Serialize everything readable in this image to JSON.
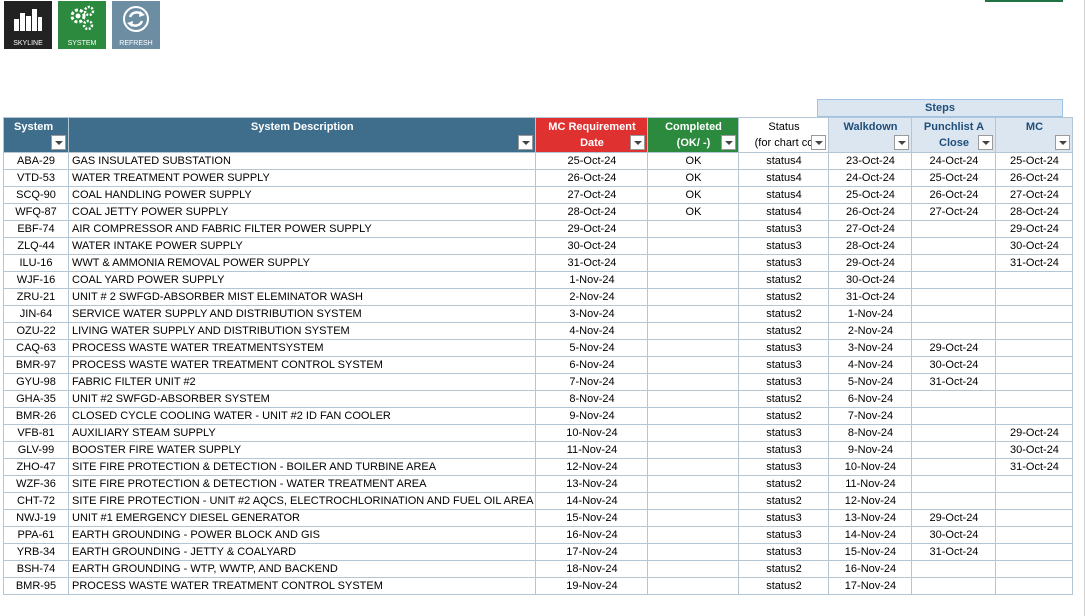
{
  "toolbar": [
    {
      "label": "SKYLINE",
      "icon": "skyline-icon"
    },
    {
      "label": "SYSTEM",
      "icon": "gears-icon"
    },
    {
      "label": "REFRESH",
      "icon": "refresh-icon"
    }
  ],
  "steps_label": "Steps",
  "headers": {
    "system": "System",
    "desc": "System Description",
    "mc_req_l1": "MC Requirement",
    "mc_req_l2": "Date",
    "completed_l1": "Completed",
    "completed_l2": "(OK/ -)",
    "status_l1": "Status",
    "status_l2": "(for chart co",
    "walkdown": "Walkdown",
    "punch_l1": "Punchlist A",
    "punch_l2": "Close",
    "mc": "MC"
  },
  "rows": [
    [
      "ABA-29",
      "GAS INSULATED SUBSTATION",
      "25-Oct-24",
      "OK",
      "status4",
      "23-Oct-24",
      "24-Oct-24",
      "25-Oct-24"
    ],
    [
      "VTD-53",
      "WATER TREATMENT POWER SUPPLY",
      "26-Oct-24",
      "OK",
      "status4",
      "24-Oct-24",
      "25-Oct-24",
      "26-Oct-24"
    ],
    [
      "SCQ-90",
      "COAL HANDLING POWER SUPPLY",
      "27-Oct-24",
      "OK",
      "status4",
      "25-Oct-24",
      "26-Oct-24",
      "27-Oct-24"
    ],
    [
      "WFQ-87",
      "COAL JETTY POWER SUPPLY",
      "28-Oct-24",
      "OK",
      "status4",
      "26-Oct-24",
      "27-Oct-24",
      "28-Oct-24"
    ],
    [
      "EBF-74",
      "AIR COMPRESSOR AND FABRIC FILTER POWER SUPPLY",
      "29-Oct-24",
      "",
      "status3",
      "27-Oct-24",
      "",
      "29-Oct-24"
    ],
    [
      "ZLQ-44",
      "WATER INTAKE POWER SUPPLY",
      "30-Oct-24",
      "",
      "status3",
      "28-Oct-24",
      "",
      "30-Oct-24"
    ],
    [
      "ILU-16",
      "WWT & AMMONIA REMOVAL POWER SUPPLY",
      "31-Oct-24",
      "",
      "status3",
      "29-Oct-24",
      "",
      "31-Oct-24"
    ],
    [
      "WJF-16",
      "COAL YARD POWER SUPPLY",
      "1-Nov-24",
      "",
      "status2",
      "30-Oct-24",
      "",
      ""
    ],
    [
      "ZRU-21",
      "UNIT # 2 SWFGD-ABSORBER MIST ELEMINATOR WASH",
      "2-Nov-24",
      "",
      "status2",
      "31-Oct-24",
      "",
      ""
    ],
    [
      "JIN-64",
      "SERVICE WATER SUPPLY AND DISTRIBUTION SYSTEM",
      "3-Nov-24",
      "",
      "status2",
      "1-Nov-24",
      "",
      ""
    ],
    [
      "OZU-22",
      "LIVING WATER SUPPLY AND DISTRIBUTION SYSTEM",
      "4-Nov-24",
      "",
      "status2",
      "2-Nov-24",
      "",
      ""
    ],
    [
      "CAQ-63",
      "PROCESS WASTE WATER TREATMENTSYSTEM",
      "5-Nov-24",
      "",
      "status3",
      "3-Nov-24",
      "29-Oct-24",
      ""
    ],
    [
      "BMR-97",
      "PROCESS WASTE WATER TREATMENT CONTROL SYSTEM",
      "6-Nov-24",
      "",
      "status3",
      "4-Nov-24",
      "30-Oct-24",
      ""
    ],
    [
      "GYU-98",
      "FABRIC FILTER UNIT #2",
      "7-Nov-24",
      "",
      "status3",
      "5-Nov-24",
      "31-Oct-24",
      ""
    ],
    [
      "GHA-35",
      "UNIT #2 SWFGD-ABSORBER SYSTEM",
      "8-Nov-24",
      "",
      "status2",
      "6-Nov-24",
      "",
      ""
    ],
    [
      "BMR-26",
      "CLOSED CYCLE COOLING WATER - UNIT #2 ID FAN COOLER",
      "9-Nov-24",
      "",
      "status2",
      "7-Nov-24",
      "",
      ""
    ],
    [
      "VFB-81",
      "AUXILIARY STEAM SUPPLY",
      "10-Nov-24",
      "",
      "status3",
      "8-Nov-24",
      "",
      "29-Oct-24"
    ],
    [
      "GLV-99",
      "BOOSTER FIRE WATER SUPPLY",
      "11-Nov-24",
      "",
      "status3",
      "9-Nov-24",
      "",
      "30-Oct-24"
    ],
    [
      "ZHO-47",
      "SITE FIRE PROTECTION & DETECTION - BOILER AND TURBINE AREA",
      "12-Nov-24",
      "",
      "status3",
      "10-Nov-24",
      "",
      "31-Oct-24"
    ],
    [
      "WZF-36",
      "SITE FIRE PROTECTION & DETECTION - WATER TREATMENT AREA",
      "13-Nov-24",
      "",
      "status2",
      "11-Nov-24",
      "",
      ""
    ],
    [
      "CHT-72",
      "SITE FIRE PROTECTION - UNIT #2 AQCS, ELECTROCHLORINATION AND FUEL OIL AREA",
      "14-Nov-24",
      "",
      "status2",
      "12-Nov-24",
      "",
      ""
    ],
    [
      "NWJ-19",
      "UNIT #1 EMERGENCY DIESEL GENERATOR",
      "15-Nov-24",
      "",
      "status3",
      "13-Nov-24",
      "29-Oct-24",
      ""
    ],
    [
      "PPA-61",
      "EARTH GROUNDING - POWER BLOCK AND GIS",
      "16-Nov-24",
      "",
      "status3",
      "14-Nov-24",
      "30-Oct-24",
      ""
    ],
    [
      "YRB-34",
      "EARTH GROUNDING - JETTY & COALYARD",
      "17-Nov-24",
      "",
      "status3",
      "15-Nov-24",
      "31-Oct-24",
      ""
    ],
    [
      "BSH-74",
      "EARTH GROUNDING - WTP, WWTP, AND BACKEND",
      "18-Nov-24",
      "",
      "status2",
      "16-Nov-24",
      "",
      ""
    ],
    [
      "BMR-95",
      "PROCESS WASTE WATER TREATMENT CONTROL SYSTEM",
      "19-Nov-24",
      "",
      "status2",
      "17-Nov-24",
      "",
      ""
    ]
  ]
}
